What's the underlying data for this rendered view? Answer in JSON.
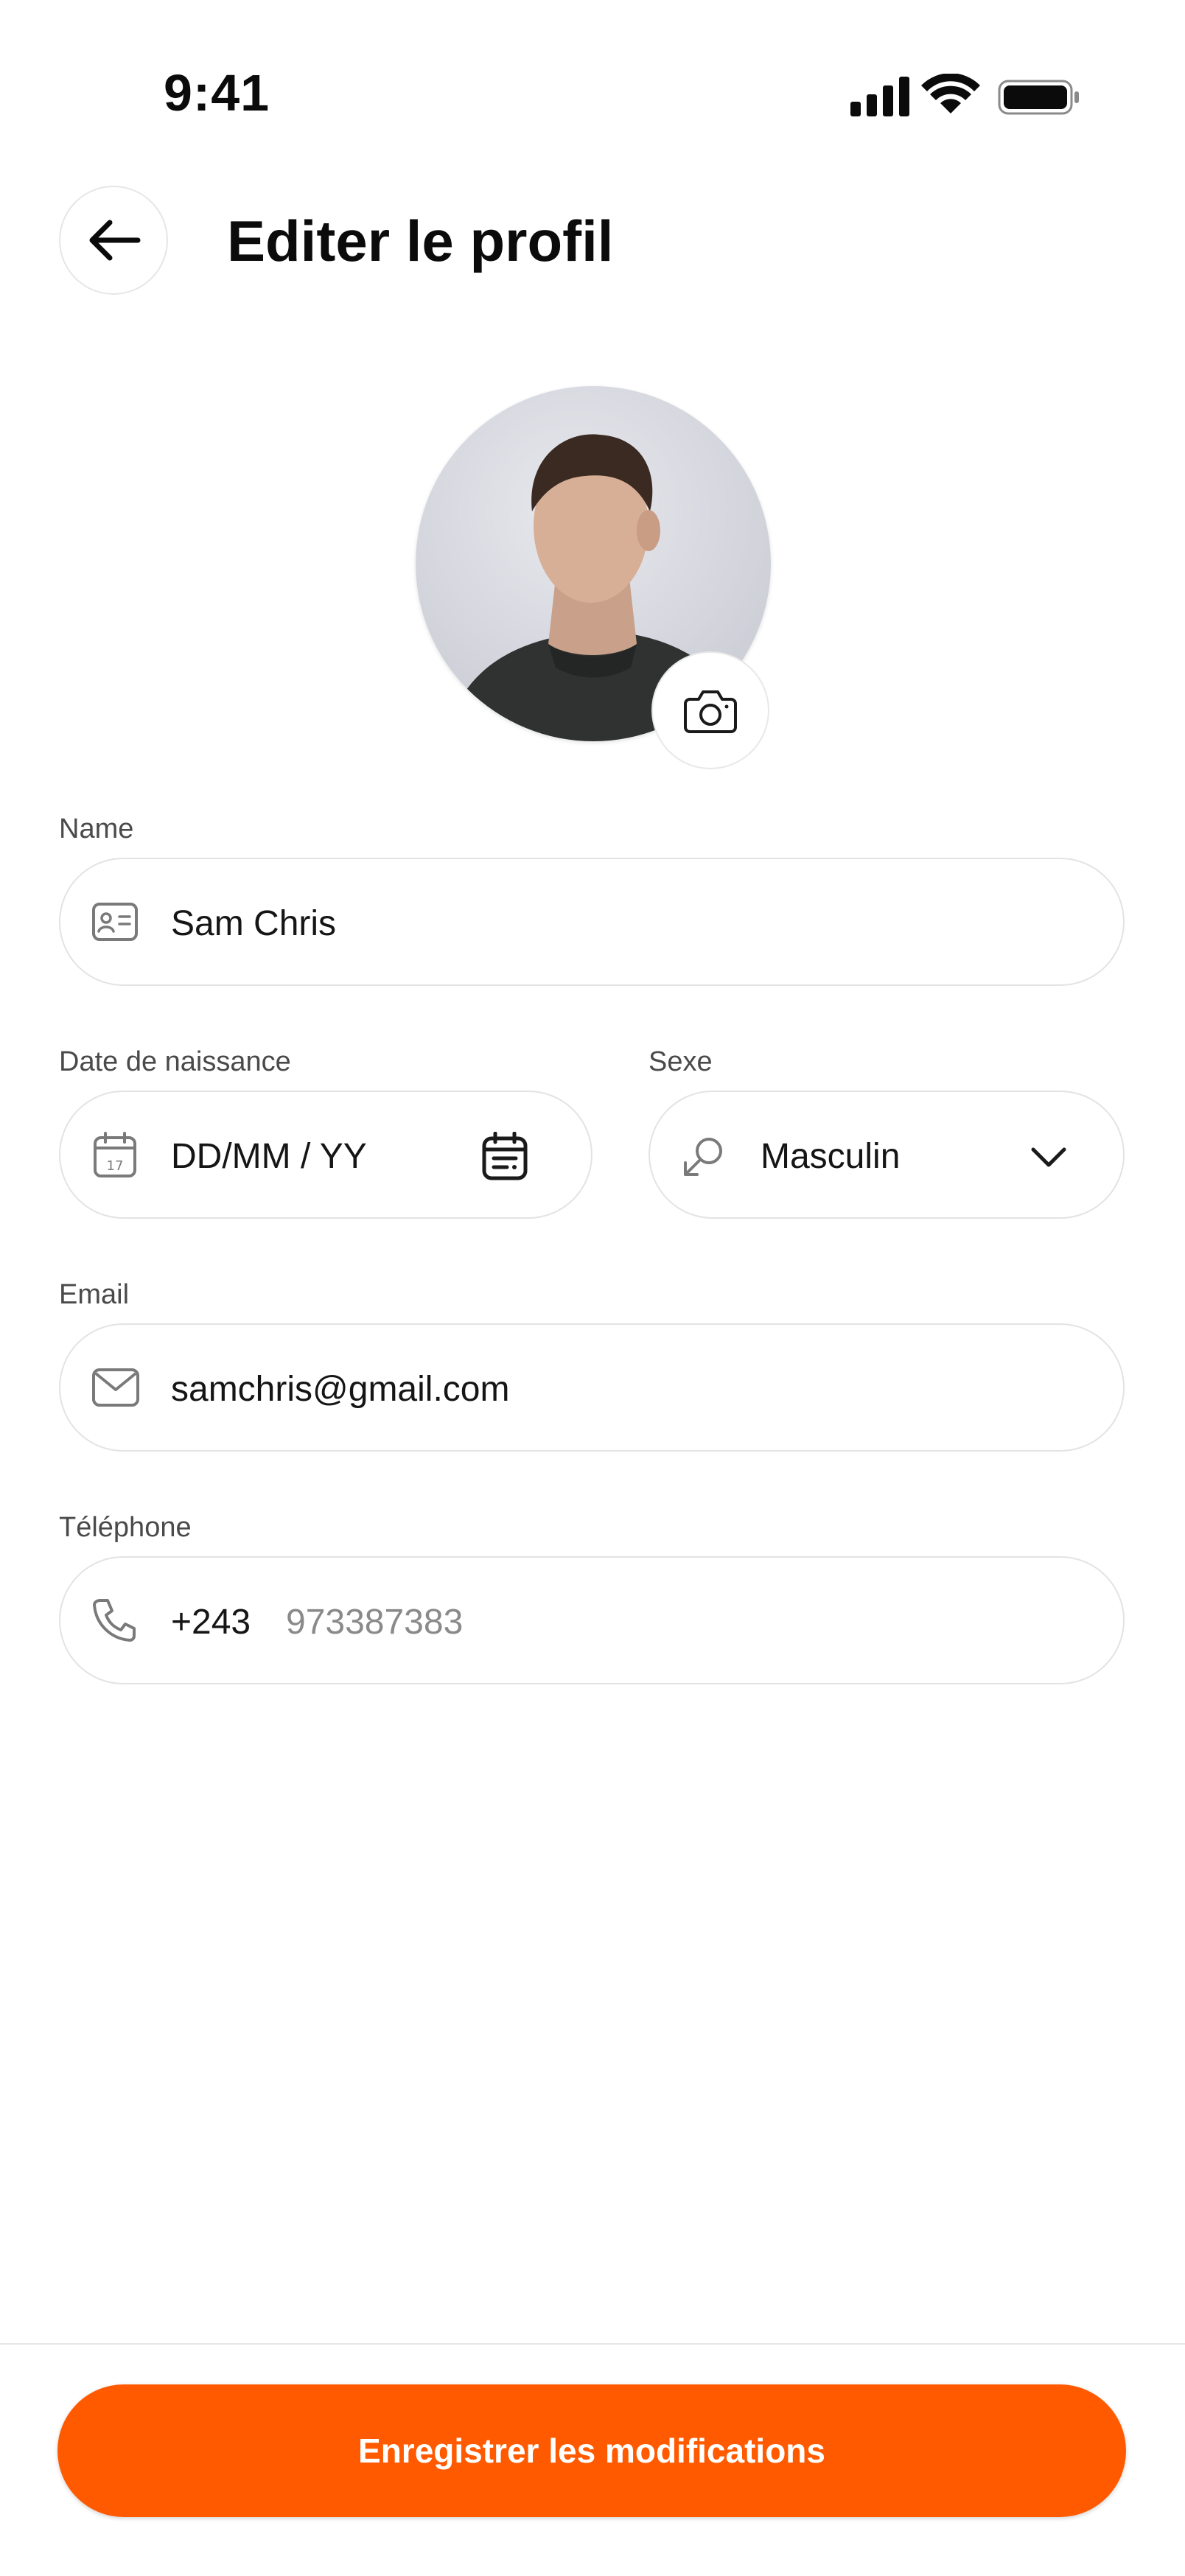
{
  "status_bar": {
    "time": "9:41"
  },
  "header": {
    "title": "Editer le profil"
  },
  "form": {
    "name": {
      "label": "Name",
      "value": "Sam Chris"
    },
    "birthdate": {
      "label": "Date de naissance",
      "placeholder": "DD/MM / YY"
    },
    "sex": {
      "label": "Sexe",
      "value": "Masculin"
    },
    "email": {
      "label": "Email",
      "value": "samchris@gmail.com"
    },
    "phone": {
      "label": "Téléphone",
      "country_code": "+243",
      "placeholder": "973387383"
    }
  },
  "footer": {
    "save_label": "Enregistrer les modifications"
  },
  "colors": {
    "accent": "#ff5a00"
  },
  "icons": [
    "back-arrow-icon",
    "camera-icon",
    "id-card-icon",
    "calendar-icon",
    "calendar-picker-icon",
    "gender-icon",
    "chevron-down-icon",
    "mail-icon",
    "phone-icon"
  ]
}
